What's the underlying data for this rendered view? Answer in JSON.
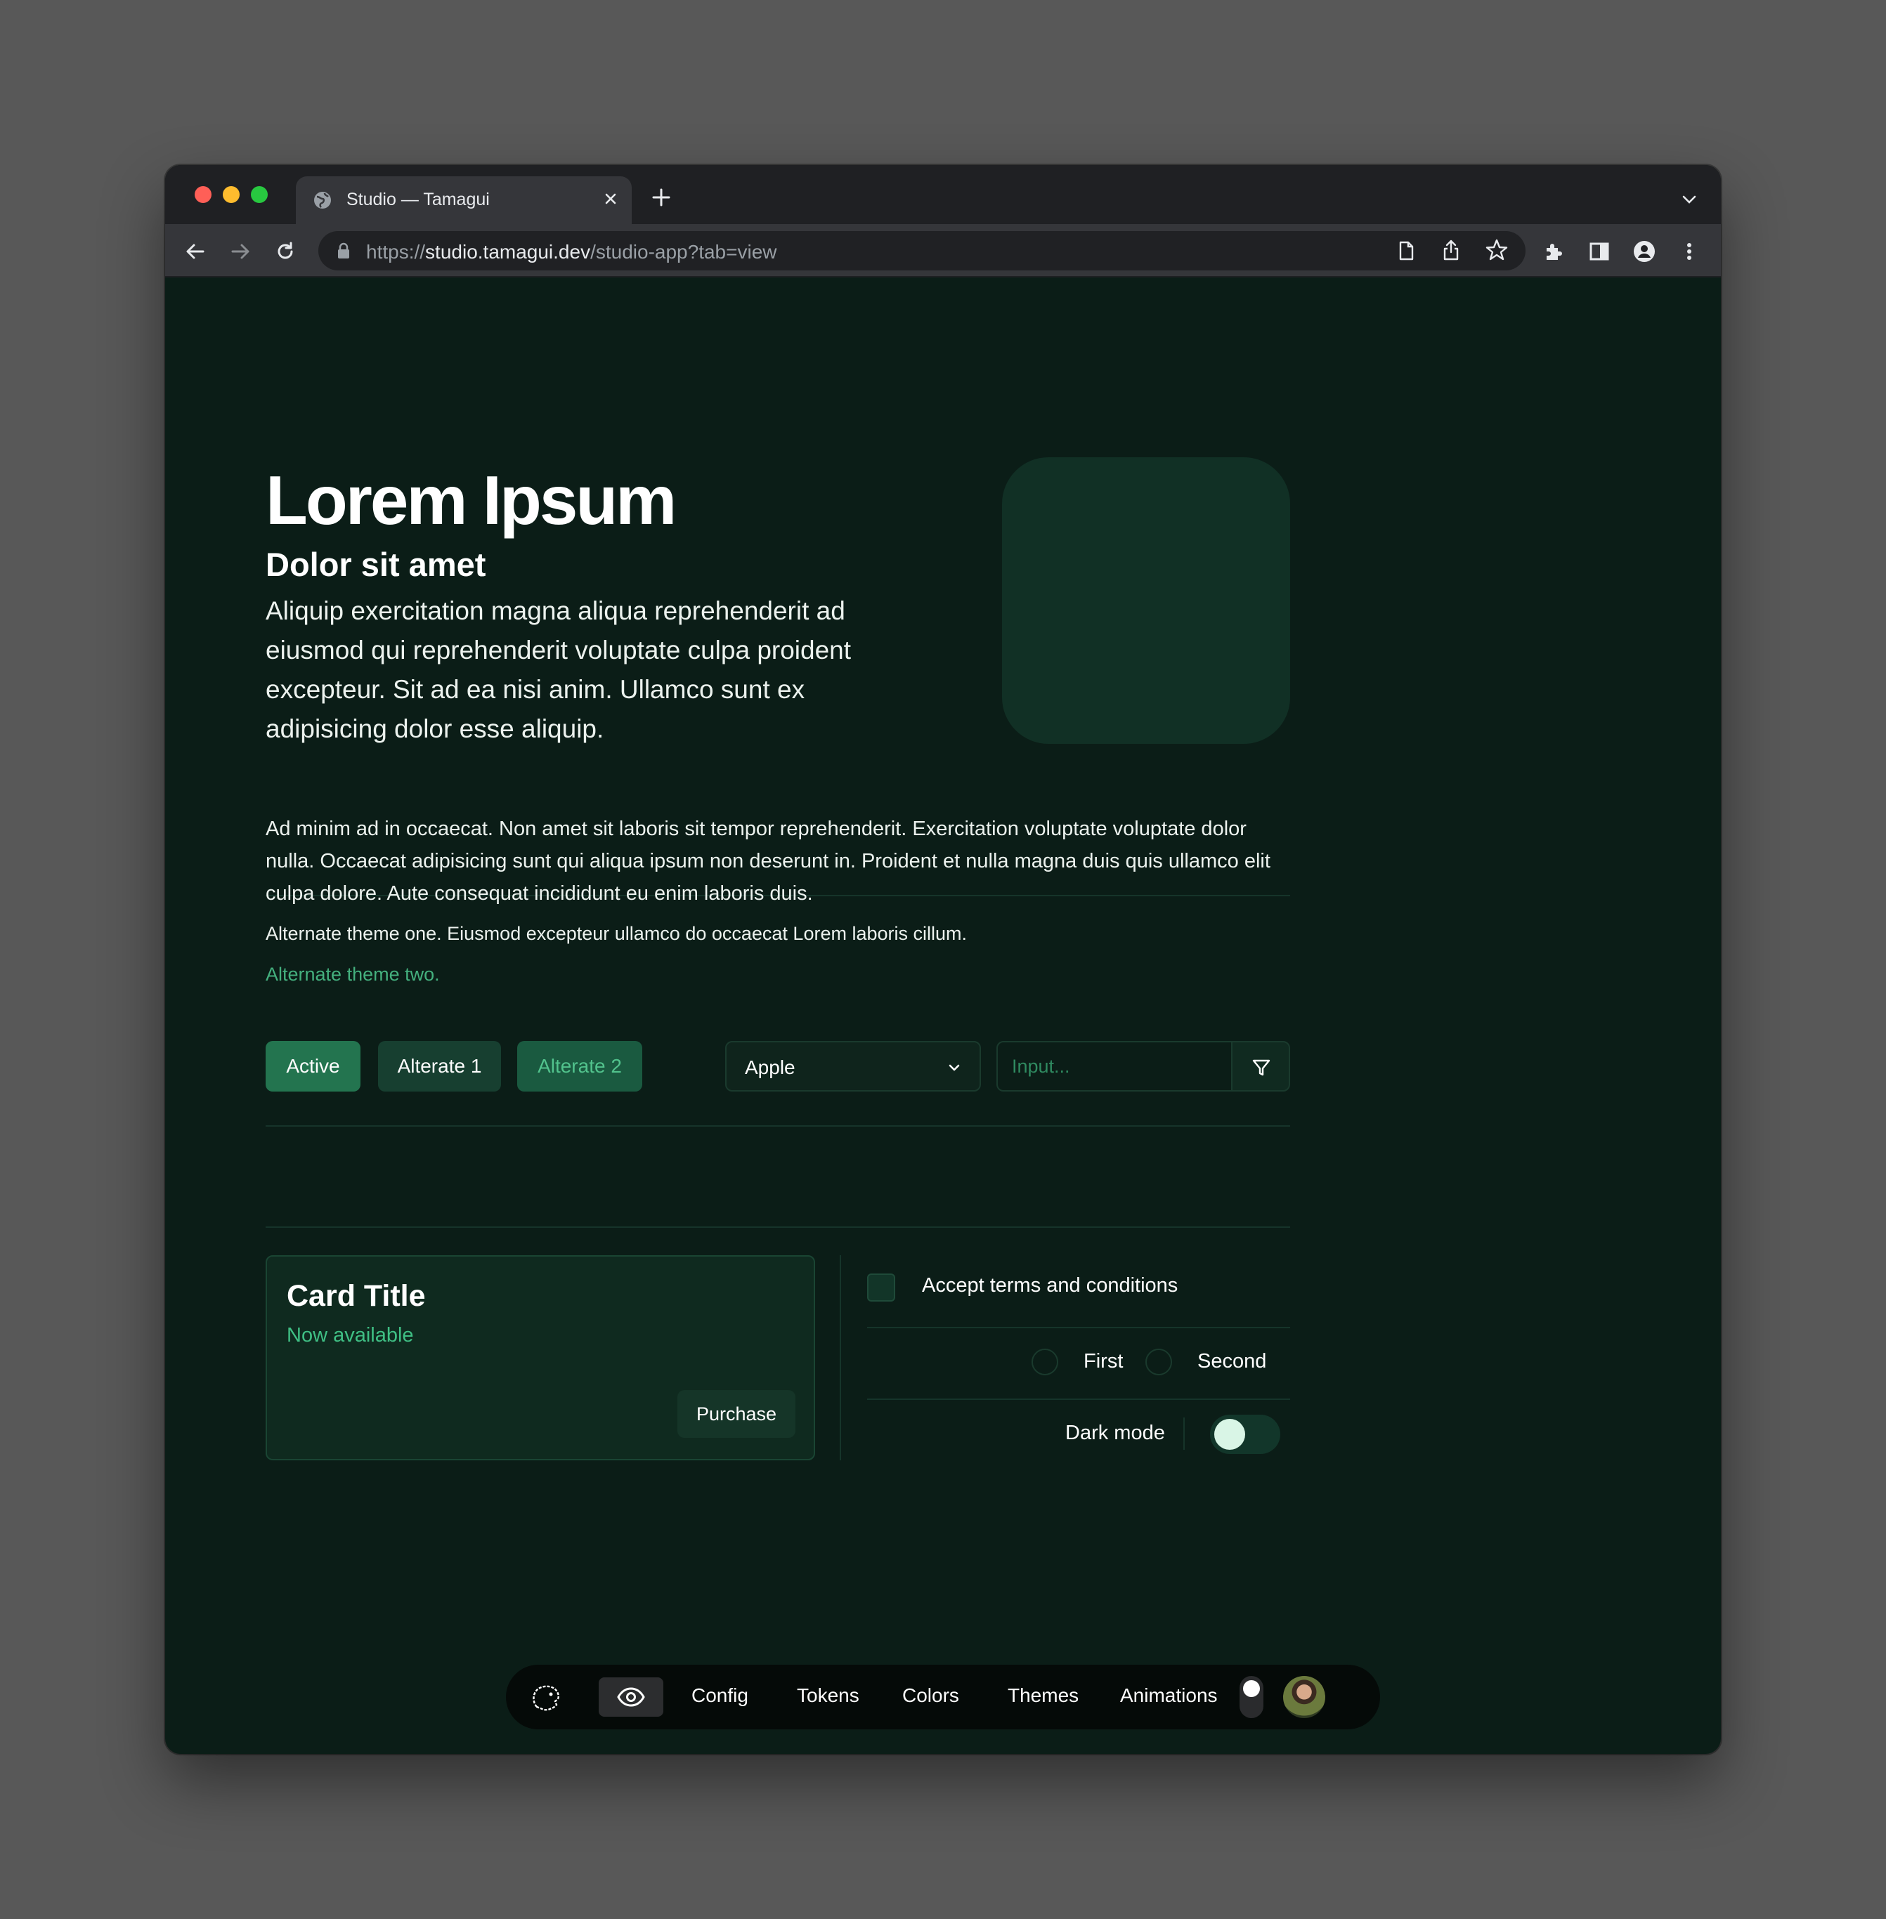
{
  "browser": {
    "tab_title": "Studio — Tamagui",
    "url_scheme": "https://",
    "url_host": "studio.tamagui.dev",
    "url_path": "/studio-app?tab=view"
  },
  "hero": {
    "title": "Lorem Ipsum",
    "subtitle": "Dolor sit amet",
    "lead": "Aliquip exercitation magna aliqua reprehenderit ad eiusmod qui reprehenderit voluptate culpa proident excepteur. Sit ad ea nisi anim. Ullamco sunt ex adipisicing dolor esse aliquip."
  },
  "body": {
    "paragraph": "Ad minim ad in occaecat. Non amet sit laboris sit tempor reprehenderit. Exercitation voluptate voluptate dolor nulla. Occaecat adipisicing sunt qui aliqua ipsum non deserunt in. Proident et nulla magna duis quis ullamco elit culpa dolore. Aute consequat incididunt eu enim laboris duis.",
    "alt_one": "Alternate theme one. Eiusmod excepteur ullamco do occaecat Lorem laboris cillum.",
    "alt_two": "Alternate theme two."
  },
  "controls": {
    "buttons": [
      "Active",
      "Alterate 1",
      "Alterate 2"
    ],
    "select_value": "Apple",
    "input_placeholder": "Input..."
  },
  "card": {
    "title": "Card Title",
    "subtitle": "Now available",
    "action": "Purchase"
  },
  "form": {
    "checkbox_label": "Accept terms and conditions",
    "checkbox_checked": false,
    "radio_options": [
      "First",
      "Second"
    ],
    "switch_label": "Dark mode",
    "switch_on": false
  },
  "dock": {
    "items": [
      "Config",
      "Tokens",
      "Colors",
      "Themes",
      "Animations"
    ]
  },
  "colors": {
    "page_bg": "#0b1d17",
    "accent": "#23744f",
    "accent_text": "#3fbf84"
  }
}
